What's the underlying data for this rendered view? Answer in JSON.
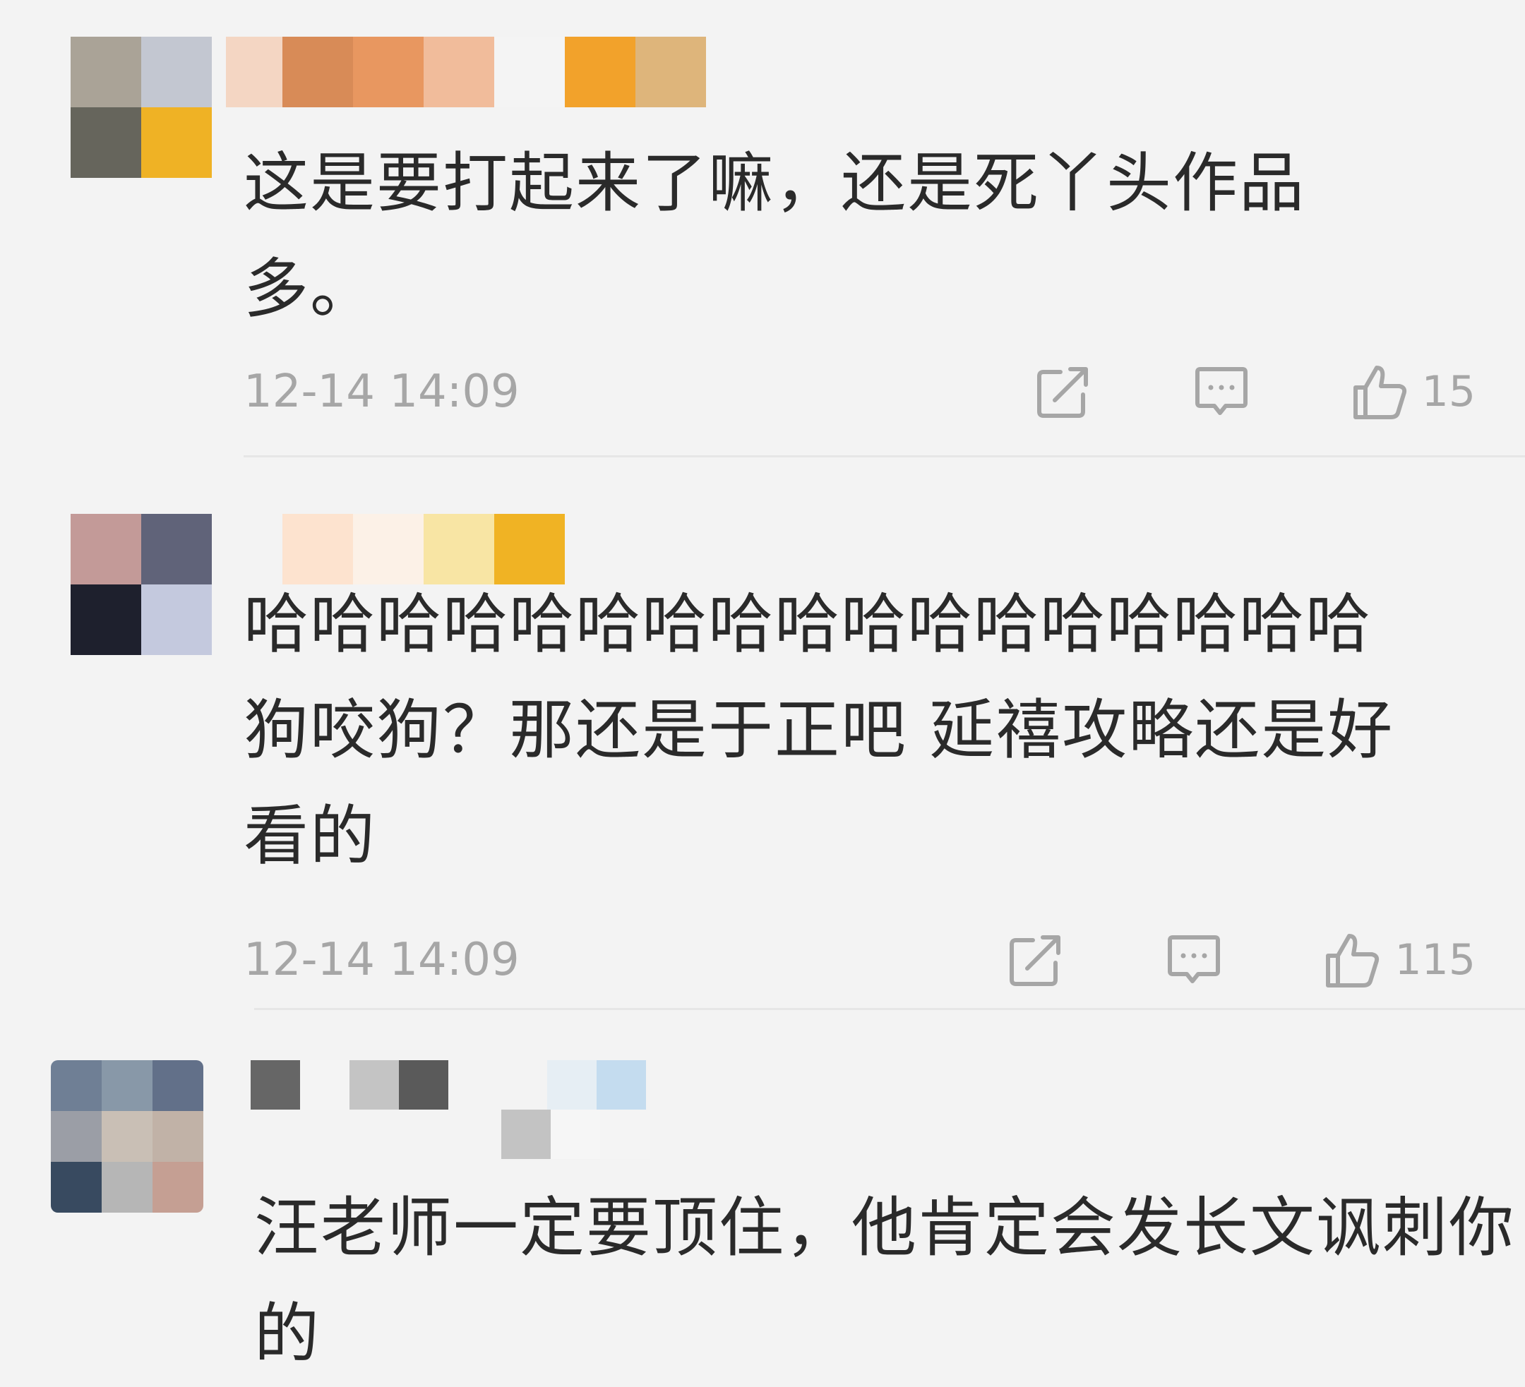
{
  "comments": [
    {
      "text": "这是要打起来了嘛，还是死丫头作品多。",
      "timestamp": "12-14 14:09",
      "like_count": "15"
    },
    {
      "text": "哈哈哈哈哈哈哈哈哈哈哈哈哈哈哈哈哈狗咬狗？那还是于正吧 延禧攻略还是好看的",
      "timestamp": "12-14 14:09",
      "like_count": "115"
    },
    {
      "text": "汪老师一定要顶住，他肯定会发长文讽刺你的"
    }
  ],
  "icons": {
    "share": "share-icon",
    "comment": "comment-icon",
    "like": "thumbs-up-icon"
  },
  "colors": {
    "background": "#f3f3f3",
    "text": "#2a2a2a",
    "meta": "#a6a6a6"
  }
}
